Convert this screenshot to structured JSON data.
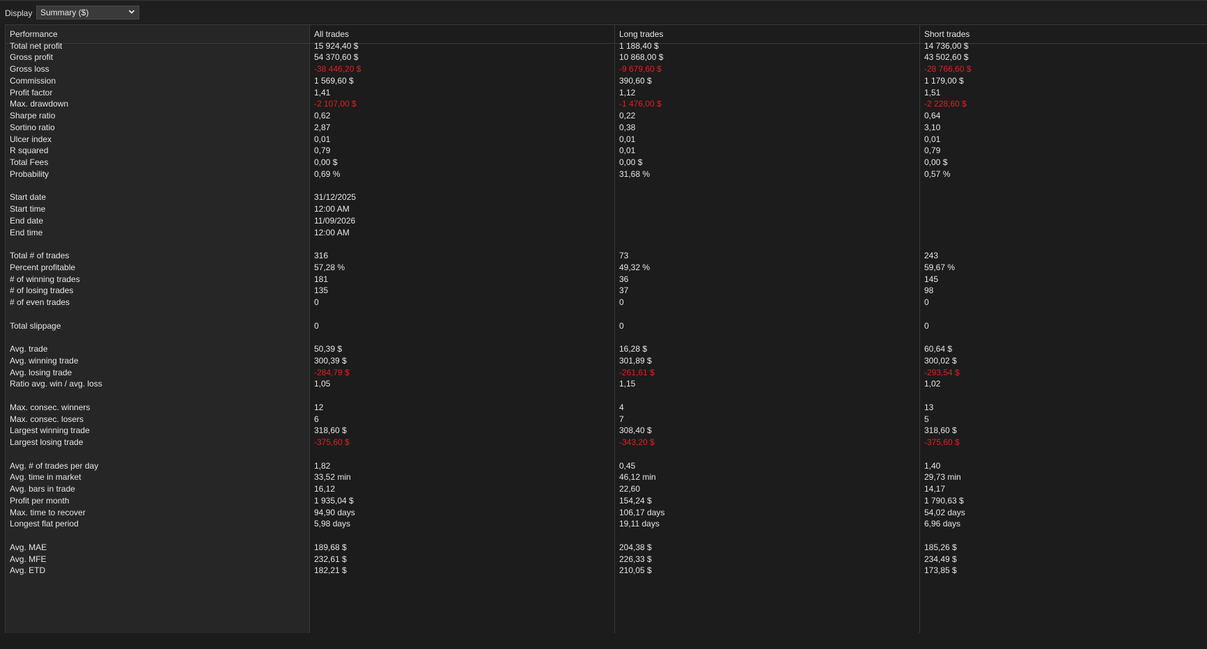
{
  "toolbar": {
    "display_label": "Display",
    "display_value": "Summary ($)",
    "dropdown_icon": "chevron-down-icon"
  },
  "table": {
    "headers": [
      "Performance",
      "All trades",
      "Long trades",
      "Short trades"
    ],
    "colors": {
      "negative": "#e02020",
      "text": "#e6e6e6",
      "background": "#1c1c1c"
    },
    "rows": [
      {
        "label": "Total net profit",
        "all": "15 924,40 $",
        "long": "1 188,40 $",
        "short": "14 736,00 $"
      },
      {
        "label": "Gross profit",
        "all": "54 370,60 $",
        "long": "10 868,00 $",
        "short": "43 502,60 $"
      },
      {
        "label": "Gross loss",
        "all": "-38 446,20 $",
        "long": "-9 679,60 $",
        "short": "-28 766,60 $",
        "negative": true
      },
      {
        "label": "Commission",
        "all": "1 569,60 $",
        "long": "390,60 $",
        "short": "1 179,00 $"
      },
      {
        "label": "Profit factor",
        "all": "1,41",
        "long": "1,12",
        "short": "1,51"
      },
      {
        "label": "Max. drawdown",
        "all": "-2 107,00 $",
        "long": "-1 476,00 $",
        "short": "-2 228,60 $",
        "negative": true
      },
      {
        "label": "Sharpe ratio",
        "all": "0,62",
        "long": "0,22",
        "short": "0,64"
      },
      {
        "label": "Sortino ratio",
        "all": "2,87",
        "long": "0,38",
        "short": "3,10"
      },
      {
        "label": "Ulcer index",
        "all": "0,01",
        "long": "0,01",
        "short": "0,01"
      },
      {
        "label": "R squared",
        "all": "0,79",
        "long": "0,01",
        "short": "0,79"
      },
      {
        "label": "Total Fees",
        "all": "0,00 $",
        "long": "0,00 $",
        "short": "0,00 $"
      },
      {
        "label": "Probability",
        "all": "0,69 %",
        "long": "31,68 %",
        "short": "0,57 %"
      },
      {
        "spacer": true
      },
      {
        "label": "Start date",
        "all": "31/12/2025",
        "long": "",
        "short": ""
      },
      {
        "label": "Start time",
        "all": "12:00 AM",
        "long": "",
        "short": ""
      },
      {
        "label": "End date",
        "all": "11/09/2026",
        "long": "",
        "short": ""
      },
      {
        "label": "End time",
        "all": "12:00 AM",
        "long": "",
        "short": ""
      },
      {
        "spacer": true
      },
      {
        "label": "Total # of trades",
        "all": "316",
        "long": "73",
        "short": "243"
      },
      {
        "label": "Percent profitable",
        "all": "57,28 %",
        "long": "49,32 %",
        "short": "59,67 %"
      },
      {
        "label": "# of winning trades",
        "all": "181",
        "long": "36",
        "short": "145"
      },
      {
        "label": "# of losing trades",
        "all": "135",
        "long": "37",
        "short": "98"
      },
      {
        "label": "# of even trades",
        "all": "0",
        "long": "0",
        "short": "0"
      },
      {
        "spacer": true
      },
      {
        "label": "Total slippage",
        "all": "0",
        "long": "0",
        "short": "0"
      },
      {
        "spacer": true
      },
      {
        "label": "Avg. trade",
        "all": "50,39 $",
        "long": "16,28 $",
        "short": "60,64 $"
      },
      {
        "label": "Avg. winning trade",
        "all": "300,39 $",
        "long": "301,89 $",
        "short": "300,02 $"
      },
      {
        "label": "Avg. losing trade",
        "all": "-284,79 $",
        "long": "-261,61 $",
        "short": "-293,54 $",
        "negative": true
      },
      {
        "label": "Ratio avg. win / avg. loss",
        "all": "1,05",
        "long": "1,15",
        "short": "1,02"
      },
      {
        "spacer": true
      },
      {
        "label": "Max. consec. winners",
        "all": "12",
        "long": "4",
        "short": "13"
      },
      {
        "label": "Max. consec. losers",
        "all": "6",
        "long": "7",
        "short": "5"
      },
      {
        "label": "Largest winning trade",
        "all": "318,60 $",
        "long": "308,40 $",
        "short": "318,60 $"
      },
      {
        "label": "Largest losing trade",
        "all": "-375,60 $",
        "long": "-343,20 $",
        "short": "-375,60 $",
        "negative": true
      },
      {
        "spacer": true
      },
      {
        "label": "Avg. # of trades per day",
        "all": "1,82",
        "long": "0,45",
        "short": "1,40"
      },
      {
        "label": "Avg. time in market",
        "all": "33,52 min",
        "long": "46,12 min",
        "short": "29,73 min"
      },
      {
        "label": "Avg. bars in trade",
        "all": "16,12",
        "long": "22,60",
        "short": "14,17"
      },
      {
        "label": "Profit per month",
        "all": "1 935,04 $",
        "long": "154,24 $",
        "short": "1 790,63 $"
      },
      {
        "label": "Max. time to recover",
        "all": "94,90 days",
        "long": "106,17 days",
        "short": "54,02 days"
      },
      {
        "label": "Longest flat period",
        "all": "5,98 days",
        "long": "19,11 days",
        "short": "6,96 days"
      },
      {
        "spacer": true
      },
      {
        "label": "Avg. MAE",
        "all": "189,68 $",
        "long": "204,38 $",
        "short": "185,26 $"
      },
      {
        "label": "Avg. MFE",
        "all": "232,61 $",
        "long": "226,33 $",
        "short": "234,49 $"
      },
      {
        "label": "Avg. ETD",
        "all": "182,21 $",
        "long": "210,05 $",
        "short": "173,85 $"
      }
    ]
  }
}
